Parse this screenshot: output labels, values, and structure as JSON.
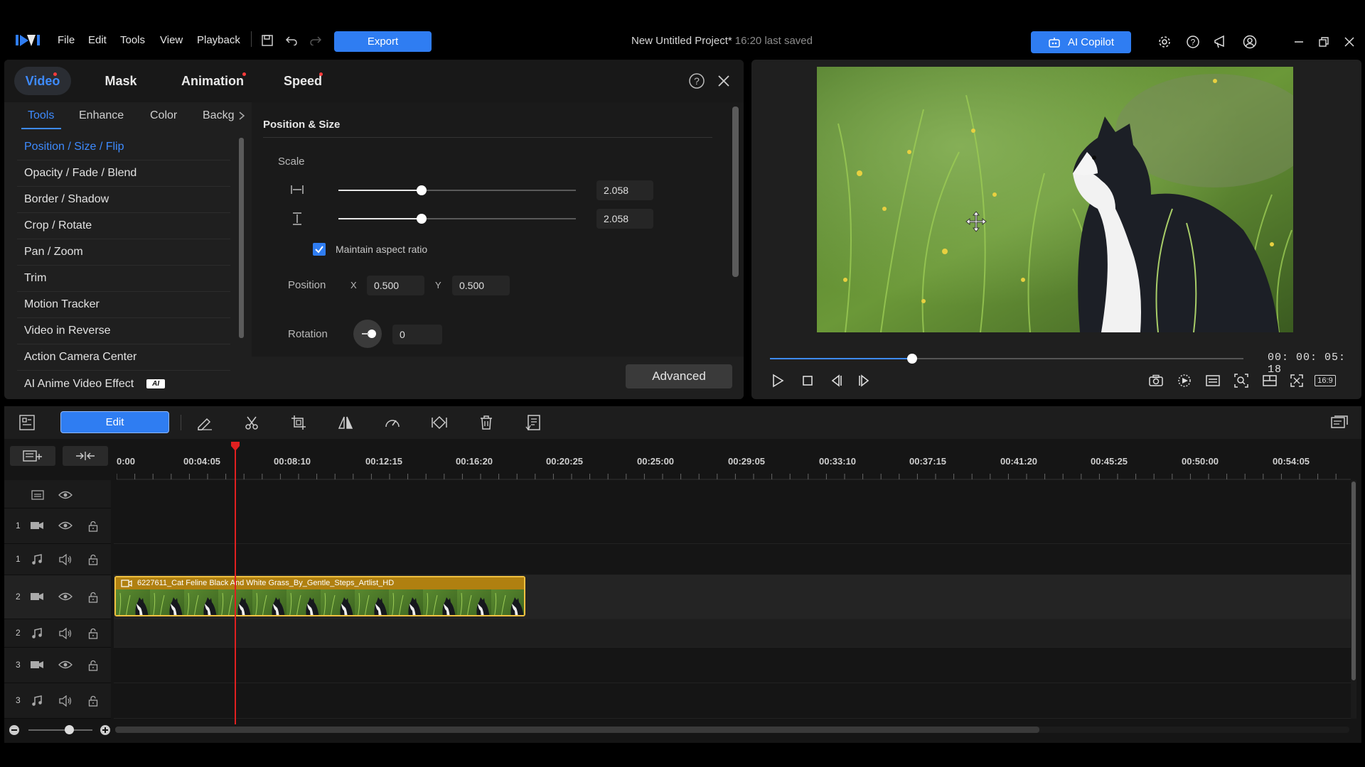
{
  "app": {
    "menu": [
      "File",
      "Edit",
      "Tools",
      "View",
      "Playback"
    ],
    "export_label": "Export",
    "project_title": "New Untitled Project*",
    "last_saved": "16:20 last saved",
    "ai_copilot_label": "AI Copilot",
    "accent": "#2f7df2"
  },
  "edit_panel": {
    "main_tabs": [
      {
        "label": "Video",
        "active": true,
        "dot": true
      },
      {
        "label": "Mask",
        "active": false,
        "dot": false
      },
      {
        "label": "Animation",
        "active": false,
        "dot": true
      },
      {
        "label": "Speed",
        "active": false,
        "dot": true
      }
    ],
    "sub_tabs": [
      "Tools",
      "Enhance",
      "Color",
      "Backg"
    ],
    "tools": [
      "Position / Size / Flip",
      "Opacity / Fade / Blend",
      "Border / Shadow",
      "Crop / Rotate",
      "Pan / Zoom",
      "Trim",
      "Motion Tracker",
      "Video in Reverse",
      "Action Camera Center",
      "AI Anime Video Effect"
    ],
    "ai_badge": "AI",
    "section_title": "Position & Size",
    "scale_label": "Scale",
    "scale_width": "2.058",
    "scale_height": "2.058",
    "scale_slider_fraction": 0.35,
    "maintain_aspect_label": "Maintain aspect ratio",
    "maintain_aspect_checked": true,
    "position_label": "Position",
    "x_label": "X",
    "x_value": "0.500",
    "y_label": "Y",
    "y_value": "0.500",
    "rotation_label": "Rotation",
    "rotation_value": "0",
    "advanced_label": "Advanced"
  },
  "preview": {
    "timecode": "00: 00: 05: 18",
    "progress_fraction": 0.3,
    "aspect_label": "16:9"
  },
  "toolbar": {
    "edit_label": "Edit"
  },
  "timeline": {
    "ruler": [
      "0:00",
      "00:04:05",
      "00:08:10",
      "00:12:15",
      "00:16:20",
      "00:20:25",
      "00:25:00",
      "00:29:05",
      "00:33:10",
      "00:37:15",
      "00:41:20",
      "00:45:25",
      "00:50:00",
      "00:54:05"
    ],
    "tracks": [
      {
        "num": "1",
        "kind": "video"
      },
      {
        "num": "1",
        "kind": "audio"
      },
      {
        "num": "2",
        "kind": "video"
      },
      {
        "num": "2",
        "kind": "audio"
      },
      {
        "num": "3",
        "kind": "video"
      },
      {
        "num": "3",
        "kind": "audio"
      }
    ],
    "clip_title": "6227611_Cat Feline Black And White Grass_By_Gentle_Steps_Artlist_HD"
  }
}
